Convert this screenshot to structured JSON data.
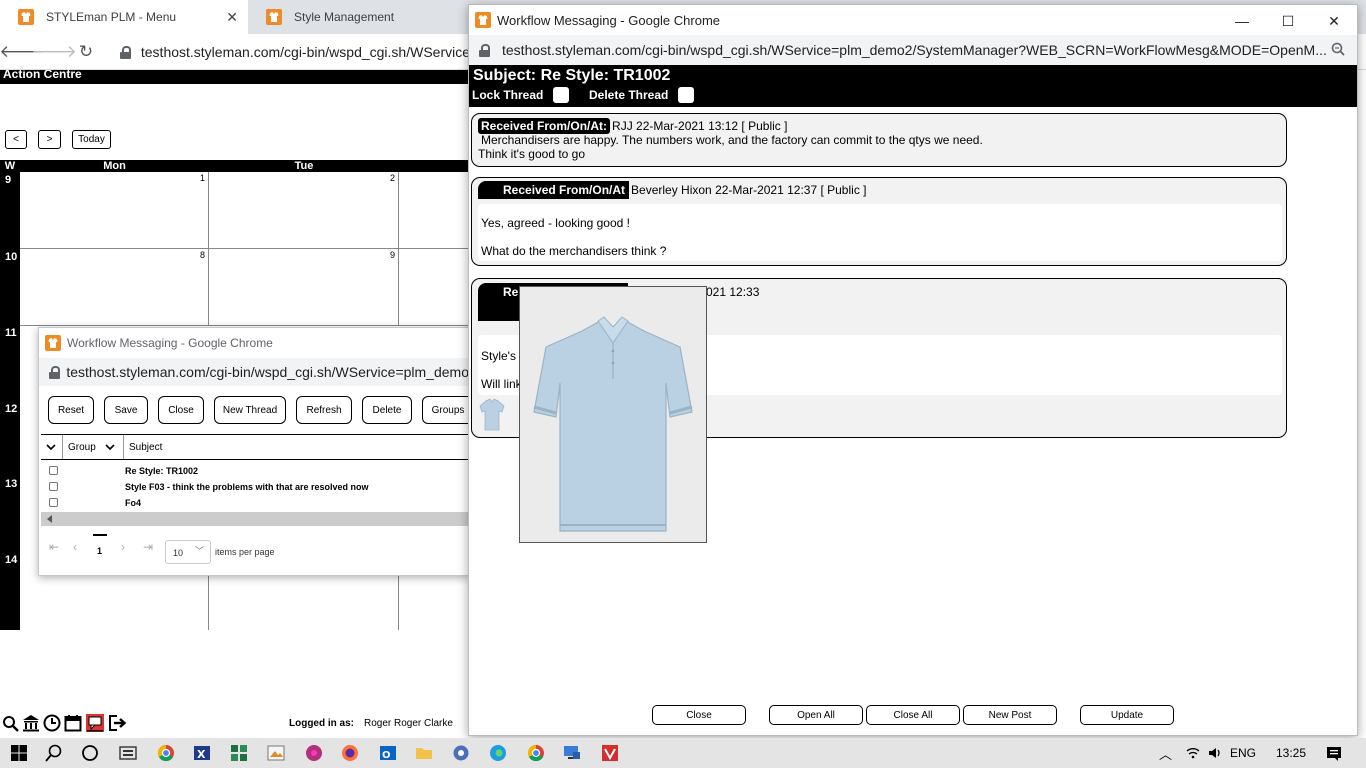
{
  "main_window": {
    "tabs": [
      {
        "title": "STYLEman PLM - Menu",
        "close": "✕"
      },
      {
        "title": "Style Management"
      }
    ],
    "url": "testhost.styleman.com/cgi-bin/wspd_cgi.sh/WService",
    "action_centre": "Action Centre",
    "cal_nav": {
      "prev": "<",
      "next": ">",
      "today": "Today"
    },
    "calendar": {
      "week_header": "W",
      "days": [
        "Mon",
        "Tue"
      ],
      "weeks": [
        "9",
        "10",
        "11",
        "12",
        "13",
        "14"
      ],
      "dates": [
        [
          "1",
          "2"
        ],
        [
          "8",
          "9"
        ]
      ]
    },
    "logged_in_label": "Logged in as:",
    "logged_in_user": "Roger  Roger Clarke"
  },
  "small_window": {
    "title": "Workflow Messaging - Google Chrome",
    "url": "testhost.styleman.com/cgi-bin/wspd_cgi.sh/WService=plm_demo",
    "buttons": [
      "Reset",
      "Save",
      "Close",
      "New Thread",
      "Refresh",
      "Delete",
      "Groups"
    ],
    "columns": {
      "group": "Group",
      "subject": "Subject"
    },
    "rows": [
      {
        "subject": "Re Style: TR1002"
      },
      {
        "subject": "Style F03 - think the problems with that are resolved now"
      },
      {
        "subject": "Fo4"
      }
    ],
    "pager": {
      "page": "1",
      "page_size": "10",
      "per_page_label": "items per page"
    }
  },
  "big_window": {
    "title": "Workflow Messaging - Google Chrome",
    "url": "testhost.styleman.com/cgi-bin/wspd_cgi.sh/WService=plm_demo2/SystemManager?WEB_SCRN=WorkFlowMesg&MODE=OpenM...",
    "subject": "Subject: Re Style: TR1002",
    "lock_thread": "Lock Thread",
    "delete_thread": "Delete Thread",
    "messages": [
      {
        "label": "Received From/On/At:",
        "meta": "RJJ 22-Mar-2021 13:12  [ Public ]",
        "lines": [
          "Merchandisers are happy. The numbers work, and the factory can commit to the qtys we need.",
          "Think it's good to go"
        ]
      },
      {
        "label": "Received From/On/At",
        "meta": "Beverley Hixon  22-Mar-2021 12:37   [ Public ]",
        "lines": [
          "Yes, agreed - looking good !",
          "What do the merchandisers think ?"
        ]
      },
      {
        "label": "Re",
        "meta": "021 12:33",
        "lines": [
          "Style's",
          "Will link"
        ]
      }
    ],
    "buttons": [
      "Close",
      "Open All",
      "Close All",
      "New Post",
      "Update"
    ]
  },
  "taskbar": {
    "lang": "ENG",
    "time": "13:25"
  },
  "colors": {
    "black_bar": "#000000",
    "shirt": "#b9d1e2",
    "favicon": "#f08a24"
  }
}
